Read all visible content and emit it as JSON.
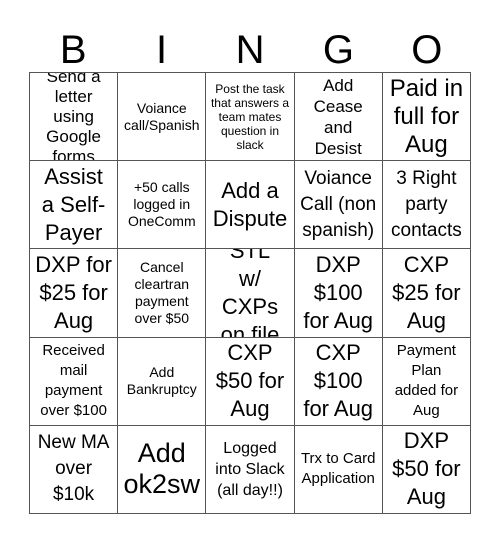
{
  "header": {
    "letters": [
      "B",
      "I",
      "N",
      "G",
      "O"
    ]
  },
  "cells": [
    "Send a letter using Google forms",
    "Voiance call/Spanish",
    "Post the task that answers a team mates question in slack",
    "Add Cease and Desist",
    "Paid in full for Aug",
    "Assist a Self-Payer",
    "+50 calls logged in OneComm",
    "Add a Dispute",
    "Voiance Call (non spanish)",
    "3 Right party contacts",
    "DXP for $25 for Aug",
    "Cancel cleartran payment over $50",
    "STL w/ CXPs on file",
    "DXP $100 for Aug",
    "CXP $25 for Aug",
    "Received mail payment over $100",
    "Add Bankruptcy",
    "CXP $50 for Aug",
    "CXP $100 for Aug",
    "Payment Plan added for Aug",
    "New MA over $10k",
    "Add ok2sw",
    "Logged into Slack (all day!!)",
    "Trx to Card Application",
    "DXP $50 for Aug"
  ]
}
